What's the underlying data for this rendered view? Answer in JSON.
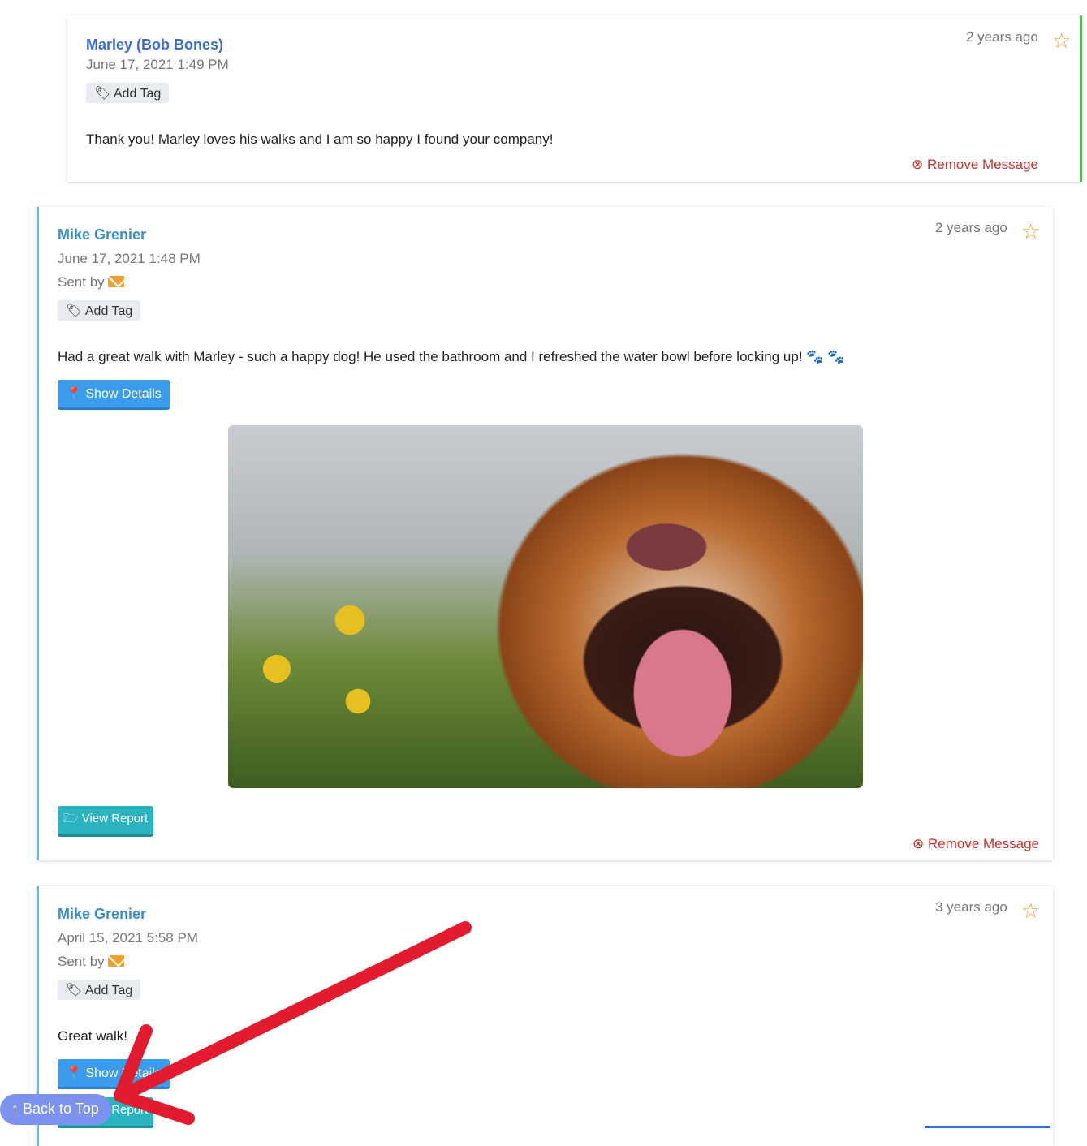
{
  "messages": [
    {
      "sender": "Marley (Bob Bones)",
      "date": "June 17, 2021 1:49 PM",
      "tag_label": "Add Tag",
      "time_ago": "2 years ago",
      "text": "Thank you! Marley loves his walks and I am so happy I found your company!",
      "remove_label": "Remove Message",
      "starred": false
    },
    {
      "sender": "Mike Grenier",
      "date": "June 17, 2021 1:48 PM",
      "sent_by_label": "Sent by",
      "sent_via_icon": "envelope-icon",
      "tag_label": "Add Tag",
      "time_ago": "2 years ago",
      "text": "Had a great walk with Marley - such a happy dog! He used the bathroom and I refreshed the water bowl before locking up! 🐾 🐾",
      "show_details_label": "Show Details",
      "view_report_label": "View Report",
      "remove_label": "Remove Message",
      "starred": false
    },
    {
      "sender": "Mike Grenier",
      "date": "April 15, 2021 5:58 PM",
      "sent_by_label": "Sent by",
      "sent_via_icon": "envelope-icon",
      "tag_label": "Add Tag",
      "time_ago": "3 years ago",
      "text": "Great walk!",
      "show_details_label": "Show Details",
      "view_report_label": "View Report",
      "starred": false
    }
  ],
  "back_to_top_label": "↑ Back to Top",
  "colors": {
    "accent": "#3b9cee",
    "teal": "#2bb3c0",
    "remove": "#c9302c",
    "star": "#f0a030",
    "annotation_arrow": "#e31b2f"
  }
}
